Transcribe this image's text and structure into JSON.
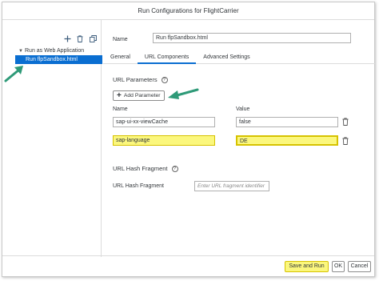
{
  "dialog": {
    "title": "Run Configurations for FlightCarrier"
  },
  "sidebar": {
    "toolbar_icons": [
      "add-icon",
      "trash-icon",
      "copy-icon"
    ],
    "group_label": "Run as Web Application",
    "selected_item": "Run flpSandbox.html"
  },
  "form": {
    "name_label": "Name",
    "name_value": "Run flpSandbox.html",
    "tabs": [
      {
        "label": "General"
      },
      {
        "label": "URL Components"
      },
      {
        "label": "Advanced Settings"
      }
    ],
    "active_tab": "URL Components",
    "url_parameters_title": "URL Parameters",
    "add_parameter_label": "Add Parameter",
    "col_name": "Name",
    "col_value": "Value",
    "params": [
      {
        "name": "sap-ui-xx-viewCache",
        "value": "false"
      },
      {
        "name": "sap-language",
        "value": "DE"
      }
    ],
    "hash_title": "URL Hash Fragment",
    "hash_label": "URL Hash Fragment",
    "hash_placeholder": "Enter URL fragment identifier"
  },
  "footer": {
    "save_run_label": "Save and Run",
    "ok_label": "OK",
    "cancel_label": "Cancel"
  },
  "colors": {
    "accent": "#0a6ed1",
    "highlight": "#fbf77d",
    "arrow": "#2e9a78"
  }
}
